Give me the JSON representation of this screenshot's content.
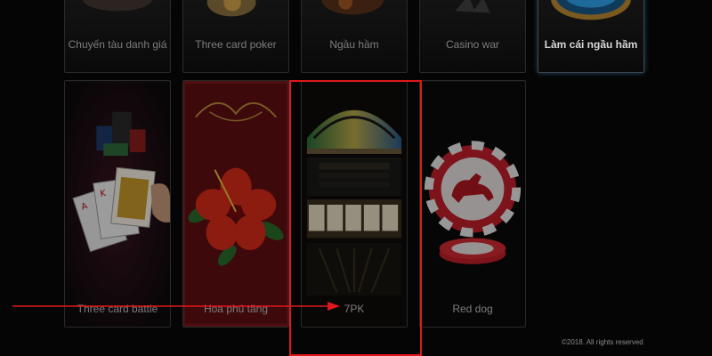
{
  "games_top": [
    {
      "label": "Chuyến tàu danh giá"
    },
    {
      "label": "Three card poker"
    },
    {
      "label": "Ngầu hầm"
    },
    {
      "label": "Casino war"
    },
    {
      "label": "Làm cái ngầu hầm"
    }
  ],
  "games_bottom": [
    {
      "label": "Three card battle"
    },
    {
      "label": "Hoa phú tăng"
    },
    {
      "label": "7PK"
    },
    {
      "label": "Red dog"
    }
  ],
  "footer": {
    "copyright": "©2018. All rights reserved"
  },
  "colors": {
    "annotation": "#e0181a",
    "background": "#050505"
  },
  "icons": [
    "cards-icon",
    "hibiscus-icon",
    "slot-machine-icon",
    "poker-chip-icon"
  ]
}
